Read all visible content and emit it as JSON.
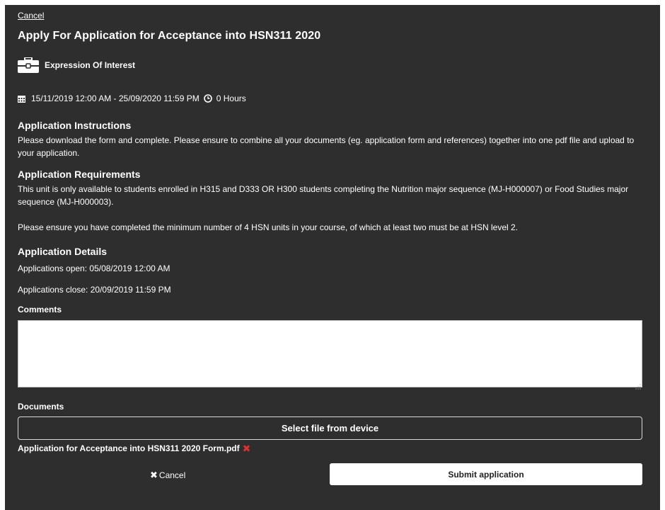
{
  "header": {
    "cancel_link": "Cancel",
    "title": "Apply For Application for Acceptance into HSN311 2020"
  },
  "type": {
    "icon": "briefcase-icon",
    "label": "Expression Of Interest"
  },
  "period": {
    "calendar_icon": "calendar-icon",
    "range": "15/11/2019 12:00 AM - 25/09/2020 11:59 PM",
    "clock_icon": "clock-icon",
    "hours": "0 Hours"
  },
  "instructions": {
    "heading": "Application Instructions",
    "text": "Please download the form and complete. Please ensure to combine all your documents (eg. application form and references) together into one pdf file and upload to your application."
  },
  "requirements": {
    "heading": "Application Requirements",
    "text1": "This unit is only available to students enrolled in H315 and D333 OR H300 students completing the Nutrition major sequence (MJ-H000007) or Food Studies major sequence (MJ-H000003).",
    "text2": "Please ensure you have completed the minimum number of 4 HSN units in your course, of which at least two must be at HSN level 2."
  },
  "details": {
    "heading": "Application Details",
    "open": "Applications open: 05/08/2019 12:00 AM",
    "close": "Applications close: 20/09/2019 11:59 PM"
  },
  "comments": {
    "label": "Comments",
    "value": ""
  },
  "documents": {
    "label": "Documents",
    "select_button": "Select file from device",
    "file_name": "Application for Acceptance into HSN311 2020 Form.pdf",
    "remove_icon": "remove-x-icon",
    "remove_glyph": "✖"
  },
  "actions": {
    "cancel_glyph": "✖",
    "cancel_label": "Cancel",
    "submit_label": "Submit application"
  },
  "colors": {
    "panel_background": "#2e2e2e",
    "text": "#ffffff",
    "remove_icon": "#e03030"
  }
}
